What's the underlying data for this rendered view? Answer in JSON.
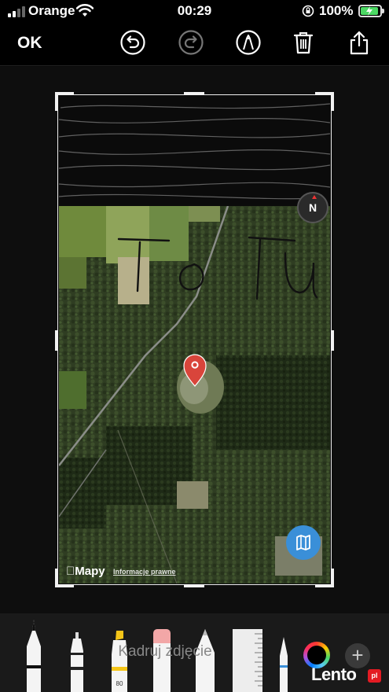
{
  "status_bar": {
    "carrier": "Orange",
    "time": "00:29",
    "battery_percent": "100%",
    "battery_level": 1.0
  },
  "toolbar": {
    "done_label": "OK",
    "icons": [
      "undo-icon",
      "redo-icon",
      "markup-pen-icon",
      "trash-icon",
      "share-icon"
    ]
  },
  "map": {
    "logo_text": "Mapy",
    "legal_text": "Informacje prawne",
    "compass_label": "N",
    "handwriting": "To Tu",
    "marker_color": "#d9453b",
    "map_button_color": "#3a8fd8"
  },
  "tools": {
    "hint_text": "Kadruj zdjęcie",
    "marker_width_label": "80",
    "items": [
      "pen-tool",
      "fineliner-tool",
      "marker-tool",
      "eraser-tool",
      "pencil-tool",
      "ruler-tool",
      "color-picker",
      "add-button"
    ]
  },
  "watermark": {
    "brand": "Lento",
    "badge": "pl"
  }
}
